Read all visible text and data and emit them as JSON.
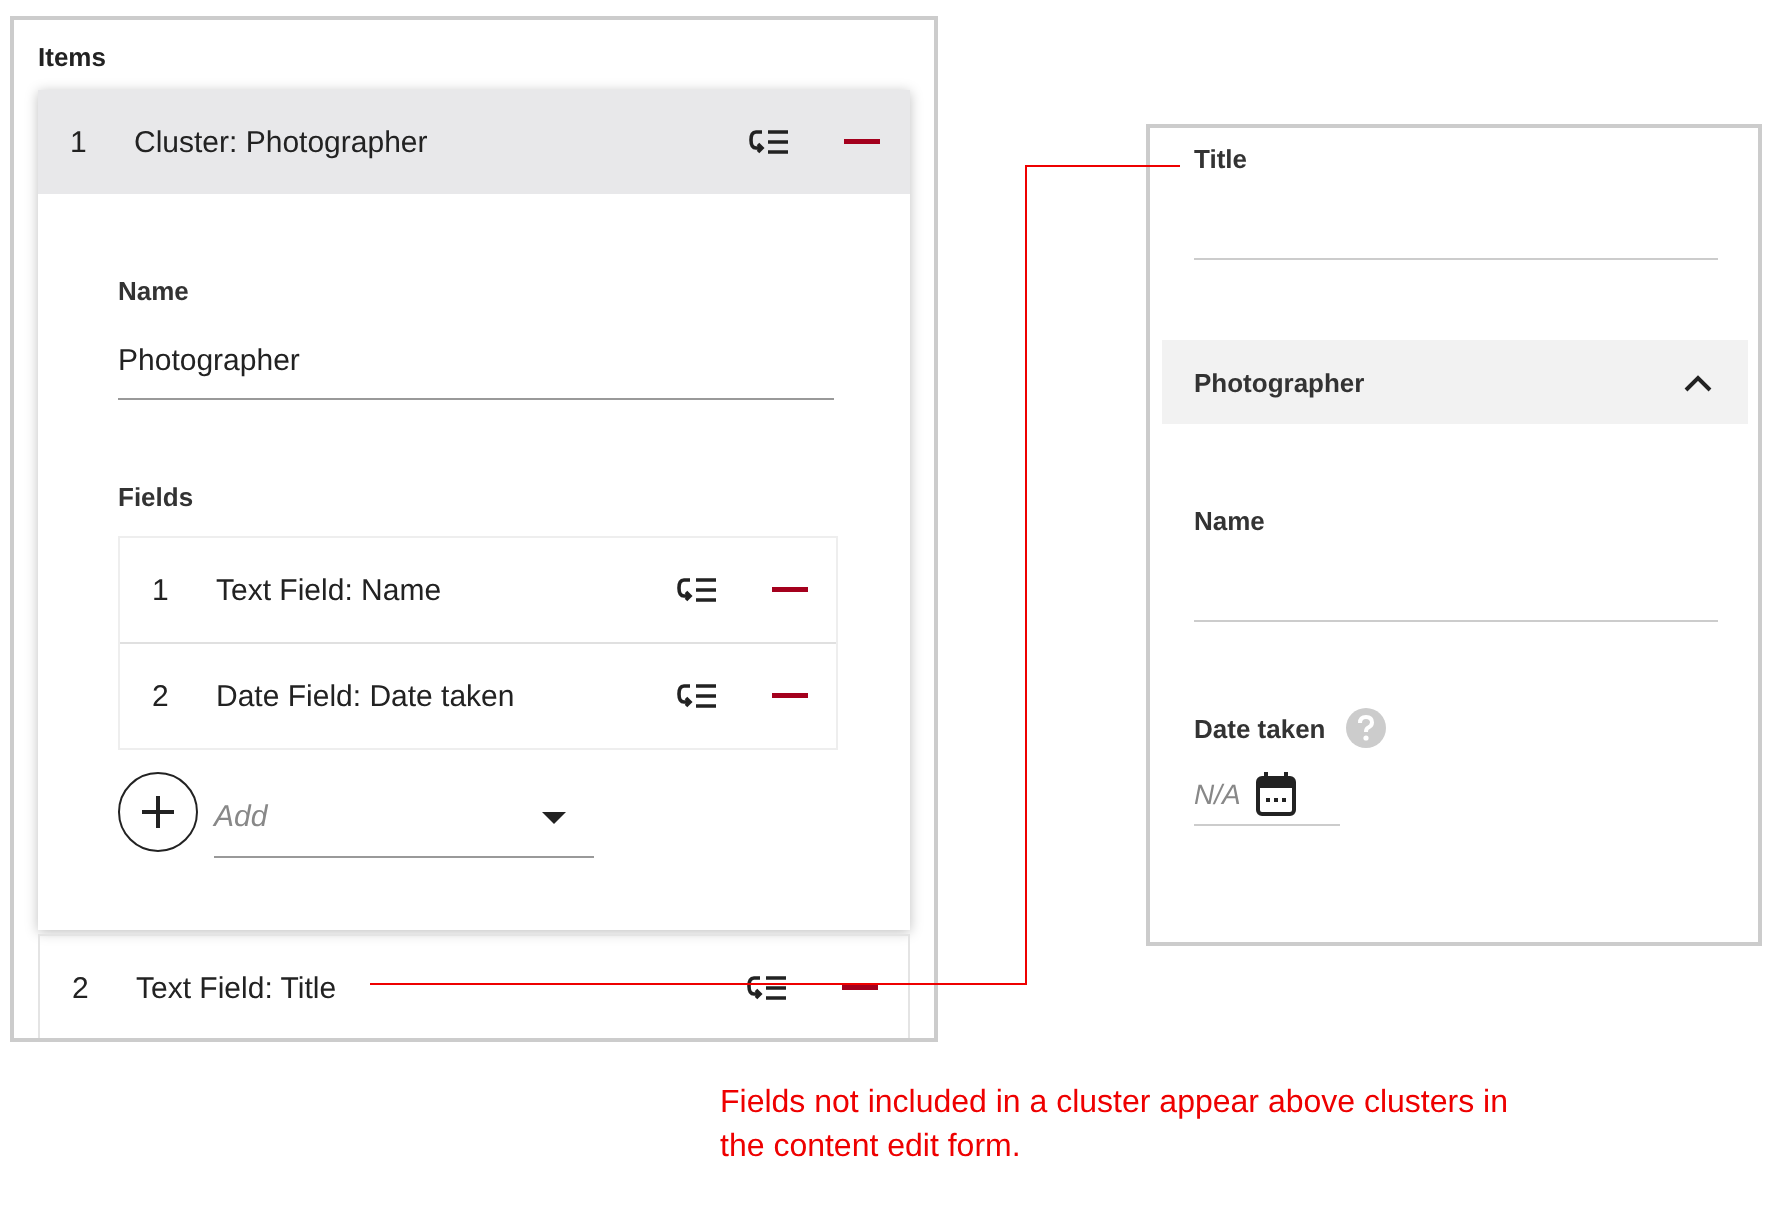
{
  "items_panel": {
    "title": "Items",
    "items": [
      {
        "kind": "cluster",
        "number": "1",
        "label": "Cluster: Photographer",
        "name_label": "Name",
        "name_value": "Photographer",
        "fields_label": "Fields",
        "fields": [
          {
            "number": "1",
            "label": "Text Field: Name"
          },
          {
            "number": "2",
            "label": "Date Field: Date taken"
          }
        ],
        "add_placeholder": "Add"
      },
      {
        "kind": "field",
        "number": "2",
        "label": "Text Field: Title"
      }
    ]
  },
  "form_preview": {
    "title_label": "Title",
    "cluster": {
      "title": "Photographer",
      "expanded": true,
      "fields": [
        {
          "kind": "text",
          "label": "Name"
        },
        {
          "kind": "date",
          "label": "Date taken",
          "placeholder": "N/A"
        }
      ]
    }
  },
  "annotation": "Fields not included in a cluster appear above clusters in the content edit form."
}
